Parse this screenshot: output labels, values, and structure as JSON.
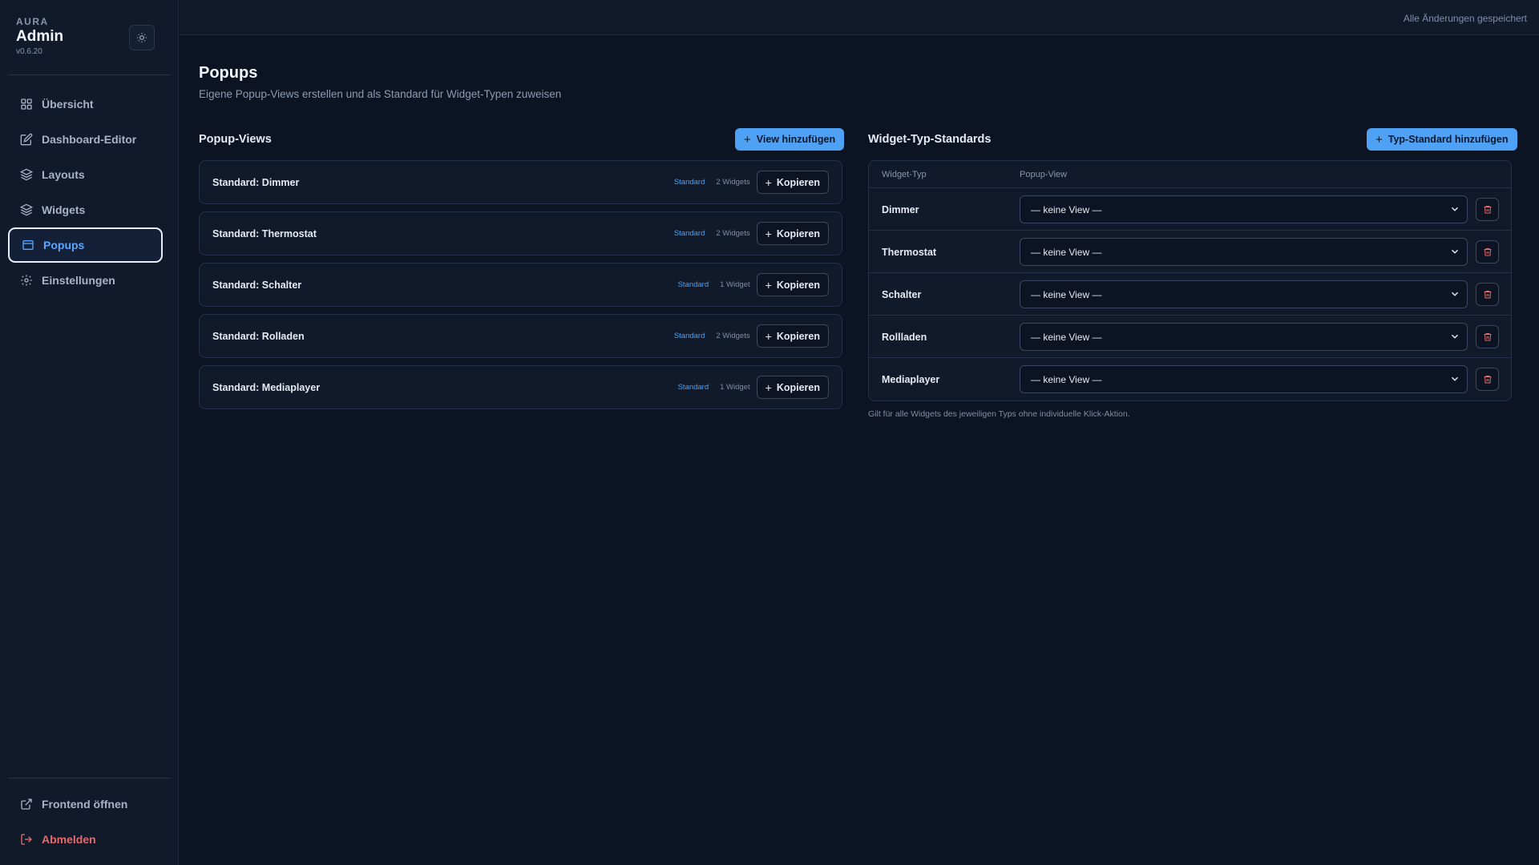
{
  "sidebar": {
    "brand_small": "AURA",
    "brand_title": "Admin",
    "version": "v0.6.20",
    "theme_icon": "sun-icon",
    "items": [
      {
        "label": "Übersicht",
        "icon": "grid-icon"
      },
      {
        "label": "Dashboard-Editor",
        "icon": "edit-icon"
      },
      {
        "label": "Layouts",
        "icon": "layers-icon"
      },
      {
        "label": "Widgets",
        "icon": "layers-icon"
      },
      {
        "label": "Popups",
        "icon": "window-icon",
        "active": true
      },
      {
        "label": "Einstellungen",
        "icon": "gear-icon"
      }
    ],
    "frontend_label": "Frontend öffnen",
    "logout_label": "Abmelden"
  },
  "topbar": {
    "status": "Alle Änderungen gespeichert"
  },
  "page": {
    "title": "Popups",
    "subtitle": "Eigene Popup-Views erstellen und als Standard für Widget-Typen zuweisen"
  },
  "views": {
    "title": "Popup-Views",
    "add_label": "View hinzufügen",
    "copy_label": "Kopieren",
    "items": [
      {
        "name": "Standard: Dimmer",
        "badge": "Standard",
        "count": "2 Widgets"
      },
      {
        "name": "Standard: Thermostat",
        "badge": "Standard",
        "count": "2 Widgets"
      },
      {
        "name": "Standard: Schalter",
        "badge": "Standard",
        "count": "1 Widget"
      },
      {
        "name": "Standard: Rolladen",
        "badge": "Standard",
        "count": "2 Widgets"
      },
      {
        "name": "Standard: Mediaplayer",
        "badge": "Standard",
        "count": "1 Widget"
      }
    ]
  },
  "standards": {
    "title": "Widget-Typ-Standards",
    "add_label": "Typ-Standard hinzufügen",
    "col_type": "Widget-Typ",
    "col_view": "Popup-View",
    "rows": [
      {
        "type": "Dimmer",
        "view": "— keine View —"
      },
      {
        "type": "Thermostat",
        "view": "— keine View —"
      },
      {
        "type": "Schalter",
        "view": "— keine View —"
      },
      {
        "type": "Rollladen",
        "view": "— keine View —"
      },
      {
        "type": "Mediaplayer",
        "view": "— keine View —"
      }
    ],
    "footnote": "Gilt für alle Widgets des jeweiligen Typs ohne individuelle Klick-Aktion."
  },
  "colors": {
    "accent": "#4ea1f5",
    "danger": "#e46b6b",
    "background": "#0c1322",
    "panel": "#111a2b"
  }
}
